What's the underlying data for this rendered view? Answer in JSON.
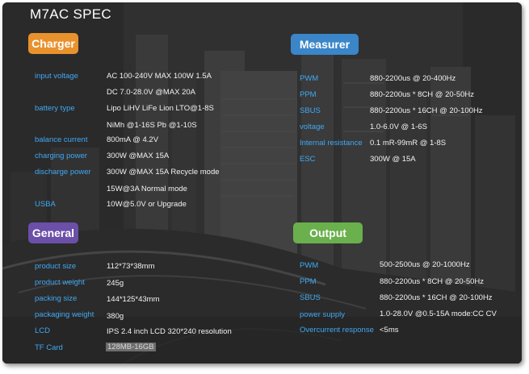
{
  "title": "M7AC SPEC",
  "sections": {
    "charger": {
      "heading": "Charger",
      "color": "#e8922e",
      "rows": [
        {
          "label": "input voltage",
          "value": "AC 100-240V MAX 100W 1.5A"
        },
        {
          "label": "",
          "value": "DC 7.0-28.0V @MAX 20A"
        },
        {
          "label": "battery type",
          "value": "Lipo LiHV LiFe Lion LTO@1-8S"
        },
        {
          "label": "",
          "value": "NiMh @1-16S Pb @1-10S"
        },
        {
          "label": "balance current",
          "value": "800mA @ 4.2V"
        },
        {
          "label": "charging power",
          "value": "300W @MAX 15A"
        },
        {
          "label": "discharge power",
          "value": "300W @MAX 15A Recycle mode"
        },
        {
          "label": "",
          "value": "15W@3A Normal mode"
        },
        {
          "label": "USBA",
          "value": "10W@5.0V or Upgrade"
        }
      ]
    },
    "measurer": {
      "heading": "Measurer",
      "color": "#3a86c8",
      "rows": [
        {
          "label": "PWM",
          "value": "880-2200us @ 20-400Hz"
        },
        {
          "label": "PPM",
          "value": "880-2200us * 8CH @ 20-50Hz"
        },
        {
          "label": "SBUS",
          "value": "880-2200us * 16CH @ 20-100Hz"
        },
        {
          "label": "voltage",
          "value": "1.0-6.0V @ 1-6S"
        },
        {
          "label": "Internal resistance",
          "value": "0.1 mR-99mR @ 1-8S"
        },
        {
          "label": "ESC",
          "value": "300W @ 15A"
        }
      ]
    },
    "general": {
      "heading": "General",
      "color": "#6b4fa8",
      "rows": [
        {
          "label": "product size",
          "value": "112*73*38mm"
        },
        {
          "label": "product weight",
          "value": "245g"
        },
        {
          "label": "packing size",
          "value": "144*125*43mm"
        },
        {
          "label": "packaging weight",
          "value": "380g"
        },
        {
          "label": "LCD",
          "value": "IPS 2.4 inch LCD 320*240 resolution"
        },
        {
          "label": "TF Card",
          "value": "128MB-16GB"
        }
      ]
    },
    "output": {
      "heading": "Output",
      "color": "#6ab04c",
      "rows": [
        {
          "label": "PWM",
          "value": "500-2500us @ 20-1000Hz"
        },
        {
          "label": "PPM",
          "value": "880-2200us * 8CH @ 20-50Hz"
        },
        {
          "label": "SBUS",
          "value": "880-2200us * 16CH @ 20-100Hz"
        },
        {
          "label": "power supply",
          "value": "1.0-28.0V @0.5-15A mode:CC CV"
        },
        {
          "label": "Overcurrent response",
          "value": "<5ms"
        }
      ]
    }
  }
}
